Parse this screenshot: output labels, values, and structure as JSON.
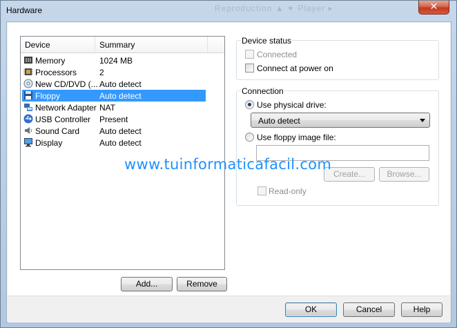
{
  "window": {
    "title": "Hardware",
    "title_ghost": "Reproduction ▲ ✦ Player ▸"
  },
  "device_list": {
    "columns": [
      "Device",
      "Summary"
    ],
    "rows": [
      {
        "icon": "memory-icon",
        "device": "Memory",
        "summary": "1024 MB",
        "selected": false
      },
      {
        "icon": "processor-icon",
        "device": "Processors",
        "summary": "2",
        "selected": false
      },
      {
        "icon": "cd-dvd-icon",
        "device": "New CD/DVD (...",
        "summary": "Auto detect",
        "selected": false
      },
      {
        "icon": "floppy-icon",
        "device": "Floppy",
        "summary": "Auto detect",
        "selected": true
      },
      {
        "icon": "network-adapter-icon",
        "device": "Network Adapter",
        "summary": "NAT",
        "selected": false
      },
      {
        "icon": "usb-icon",
        "device": "USB Controller",
        "summary": "Present",
        "selected": false
      },
      {
        "icon": "sound-card-icon",
        "device": "Sound Card",
        "summary": "Auto detect",
        "selected": false
      },
      {
        "icon": "display-icon",
        "device": "Display",
        "summary": "Auto detect",
        "selected": false
      }
    ],
    "add_label": "Add...",
    "remove_label": "Remove"
  },
  "device_status": {
    "title": "Device status",
    "connected_label": "Connected",
    "connected_checked": false,
    "connect_at_power_on_label": "Connect at power on",
    "connect_at_power_on_checked": false
  },
  "connection": {
    "title": "Connection",
    "physical_drive_label": "Use physical drive:",
    "physical_drive_selected": true,
    "drive_value": "Auto detect",
    "image_file_label": "Use floppy image file:",
    "image_file_value": "",
    "create_label": "Create...",
    "browse_label": "Browse...",
    "readonly_label": "Read-only"
  },
  "watermark": "www.tuinformaticafacil.com",
  "footer": {
    "ok_label": "OK",
    "cancel_label": "Cancel",
    "help_label": "Help"
  },
  "colors": {
    "selection": "#3399ff",
    "watermark": "#1e90ff",
    "titlebar": "#bcd0e6",
    "close": "#c2391e"
  }
}
